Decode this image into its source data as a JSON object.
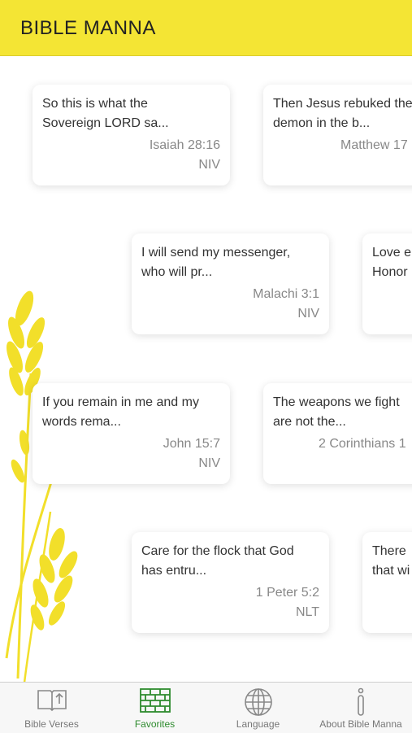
{
  "header": {
    "title": "BIBLE MANNA"
  },
  "cards": [
    {
      "text": "So this is what the\nSovereign LORD sa...",
      "ref": "Isaiah 28:16",
      "version": "NIV"
    },
    {
      "text": "Then Jesus rebuked the\ndemon in the b...",
      "ref": "Matthew 17",
      "version": ""
    },
    {
      "text": "I will send my messenger,\nwho will pr...",
      "ref": "Malachi 3:1",
      "version": "NIV"
    },
    {
      "text": "Love e\nHonor",
      "ref": "",
      "version": ""
    },
    {
      "text": "If you remain in me and my\nwords rema...",
      "ref": "John 15:7",
      "version": "NIV"
    },
    {
      "text": "The weapons we fight\nare not the...",
      "ref": "2 Corinthians 1",
      "version": ""
    },
    {
      "text": "Care for the flock that God\nhas entru...",
      "ref": "1 Peter 5:2",
      "version": "NLT"
    },
    {
      "text": "There\nthat wi",
      "ref": "",
      "version": ""
    }
  ],
  "tabs": [
    {
      "label": "Bible Verses",
      "icon": "book-icon"
    },
    {
      "label": "Favorites",
      "icon": "brick-wall-icon"
    },
    {
      "label": "Language",
      "icon": "globe-icon"
    },
    {
      "label": "About Bible Manna",
      "icon": "info-icon"
    }
  ],
  "colors": {
    "header": "#f4e534",
    "active_tab": "#2e8b2e",
    "wheat": "#f2df2a"
  }
}
